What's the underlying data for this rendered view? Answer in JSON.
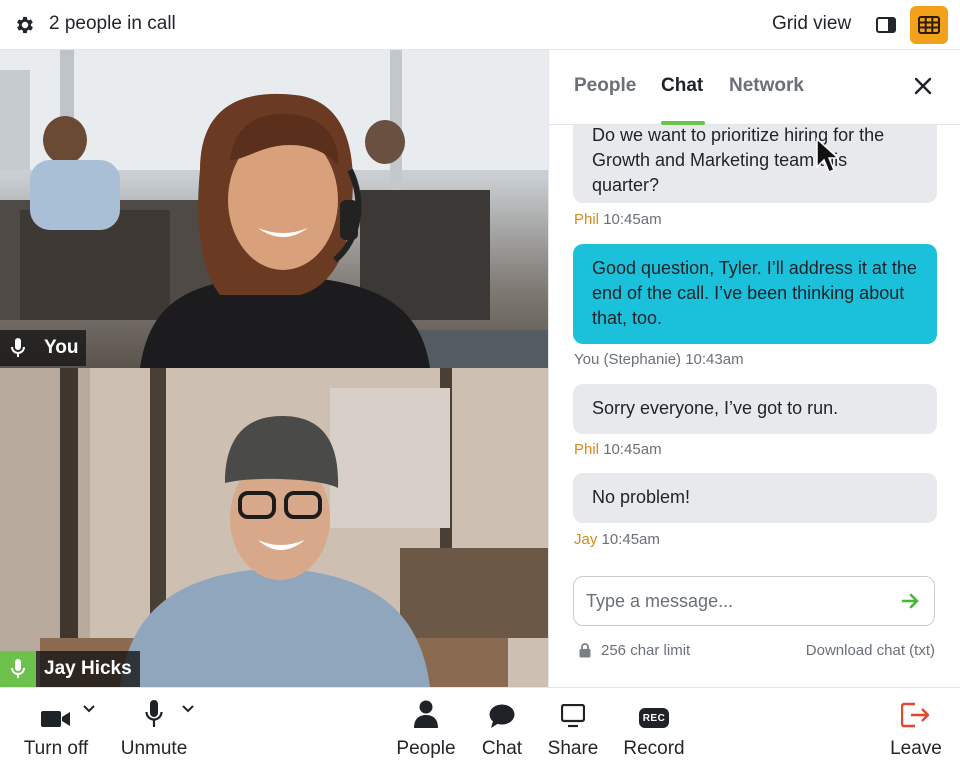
{
  "topbar": {
    "settings_icon": "gear-icon",
    "call_count": "2 people in call",
    "view_label": "Grid view",
    "sidebar_view_icon": "sidebar-layout-icon",
    "grid_view_icon": "grid-layout-icon",
    "accent_color": "#f3a01a"
  },
  "videos": [
    {
      "name": "You",
      "mic_state": "idle",
      "mic_icon": "microphone-icon"
    },
    {
      "name": "Jay Hicks",
      "mic_state": "speaking",
      "mic_icon": "microphone-icon"
    }
  ],
  "panel": {
    "tabs": [
      {
        "label": "People",
        "active": false
      },
      {
        "label": "Chat",
        "active": true
      },
      {
        "label": "Network",
        "active": false
      }
    ],
    "close_icon": "close-icon",
    "messages": [
      {
        "text": "Do we want to prioritize hiring for the Growth and Marketing team this quarter?",
        "author": "Phil",
        "time": "10:45am",
        "mine": false
      },
      {
        "text": "Good question, Tyler. I’ll address it at the end of the call. I’ve been thinking about that, too.",
        "author": "You (Stephanie)",
        "time": "10:43am",
        "mine": true
      },
      {
        "text": "Sorry everyone, I’ve got to run.",
        "author": "Phil",
        "time": "10:45am",
        "mine": false
      },
      {
        "text": "No problem!",
        "author": "Jay",
        "time": "10:45am",
        "mine": false
      }
    ],
    "input_placeholder": "Type a message...",
    "send_icon": "arrow-right-icon",
    "char_limit": "256 char limit",
    "lock_icon": "lock-icon",
    "download_label": "Download chat (txt)",
    "colors": {
      "mine_bubble": "#1bc0da",
      "other_bubble": "#e7e9ec",
      "author_name": "#d68a17",
      "tab_underline": "#6cc24a"
    }
  },
  "bottombar": {
    "camera": {
      "label": "Turn off",
      "icon": "video-camera-icon"
    },
    "mic": {
      "label": "Unmute",
      "icon": "microphone-icon"
    },
    "people": {
      "label": "People",
      "icon": "person-icon"
    },
    "chat": {
      "label": "Chat",
      "icon": "chat-bubble-icon"
    },
    "share": {
      "label": "Share",
      "icon": "screen-share-icon"
    },
    "record": {
      "label": "Record",
      "icon": "rec-icon",
      "badge": "REC"
    },
    "leave": {
      "label": "Leave",
      "icon": "exit-icon",
      "color": "#e5462f"
    }
  }
}
